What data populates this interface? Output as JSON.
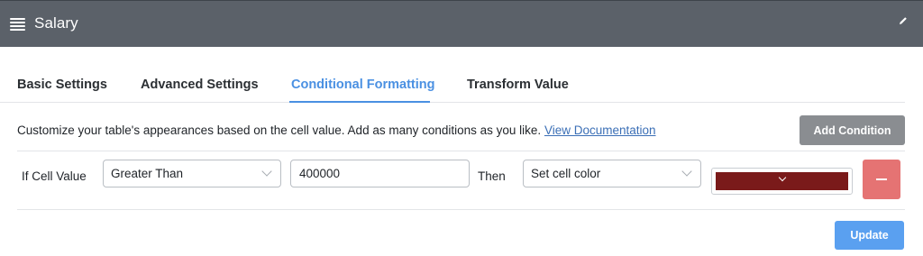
{
  "header": {
    "title": "Salary",
    "menu_icon": "hamburger-menu-icon",
    "edit_icon": "pencil-icon"
  },
  "tabs": [
    {
      "label": "Basic Settings",
      "active": false
    },
    {
      "label": "Advanced Settings",
      "active": false
    },
    {
      "label": "Conditional Formatting",
      "active": true
    },
    {
      "label": "Transform Value",
      "active": false
    }
  ],
  "description": {
    "text": "Customize your table's appearances based on the cell value. Add as many conditions as you like.",
    "link": "View Documentation"
  },
  "add_condition_label": "Add Condition",
  "condition": {
    "prefix": "If Cell Value",
    "operator": "Greater Than",
    "value": "400000",
    "then_label": "Then",
    "action": "Set cell color",
    "color": "#7a1a1a"
  },
  "update_label": "Update",
  "colors": {
    "accent": "#4a90e2",
    "header_bg": "#5b6169",
    "remove": "#e57373",
    "add_button": "#8a8d91",
    "update_button": "#5aa0f0"
  }
}
